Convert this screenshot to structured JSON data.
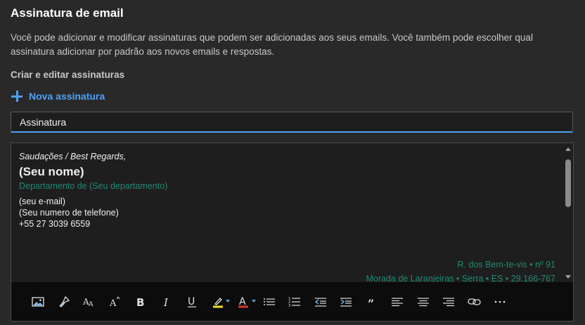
{
  "header": {
    "title": "Assinatura de email",
    "description": "Você pode adicionar e modificar assinaturas que podem ser adicionadas aos seus emails. Você também pode escolher qual assinatura adicionar por padrão aos novos emails e respostas.",
    "section_label": "Criar e editar assinaturas"
  },
  "new_signature": {
    "label": "Nova assinatura",
    "icon": "plus-icon"
  },
  "signature_name": {
    "value": "Assinatura"
  },
  "signature_body": {
    "greeting": "Saudações / Best Regards,",
    "name": "(Seu nome)",
    "department": "Departamento de (Seu departamento)",
    "email": "(seu e-mail)",
    "phone_label": "(Seu numero de telefone)",
    "phone": "+55 27 3039 6559",
    "address_line1": "R. dos Bem-te-vis • nº 91",
    "address_line2": "Morada de Laranjeiras • Serra • ES • 29.166-767"
  },
  "colors": {
    "accent": "#4ea1f7",
    "teal_text": "#1f8a72",
    "background": "#292929",
    "editor_background": "#1e1e1e",
    "toolbar_background": "#0c0c0c",
    "highlight_yellow": "#f2e21a",
    "font_color_red": "#e0322a"
  },
  "toolbar": {
    "items": [
      {
        "name": "insert-image",
        "icon": "image-icon"
      },
      {
        "name": "format-painter",
        "icon": "format-painter-icon"
      },
      {
        "name": "font-size",
        "icon": "font-size-icon"
      },
      {
        "name": "change-case",
        "icon": "change-case-icon"
      },
      {
        "name": "bold",
        "icon": "bold-icon"
      },
      {
        "name": "italic",
        "icon": "italic-icon"
      },
      {
        "name": "underline",
        "icon": "underline-icon"
      },
      {
        "name": "highlight",
        "icon": "highlight-icon"
      },
      {
        "name": "font-color",
        "icon": "font-color-icon"
      },
      {
        "name": "bullets",
        "icon": "bulleted-list-icon"
      },
      {
        "name": "numbering",
        "icon": "numbered-list-icon"
      },
      {
        "name": "decrease-indent",
        "icon": "decrease-indent-icon"
      },
      {
        "name": "increase-indent",
        "icon": "increase-indent-icon"
      },
      {
        "name": "quote",
        "icon": "quote-icon"
      },
      {
        "name": "align-left",
        "icon": "align-left-icon"
      },
      {
        "name": "align-center",
        "icon": "align-center-icon"
      },
      {
        "name": "align-right",
        "icon": "align-right-icon"
      },
      {
        "name": "link",
        "icon": "link-icon"
      },
      {
        "name": "more",
        "icon": "more-icon"
      }
    ]
  }
}
